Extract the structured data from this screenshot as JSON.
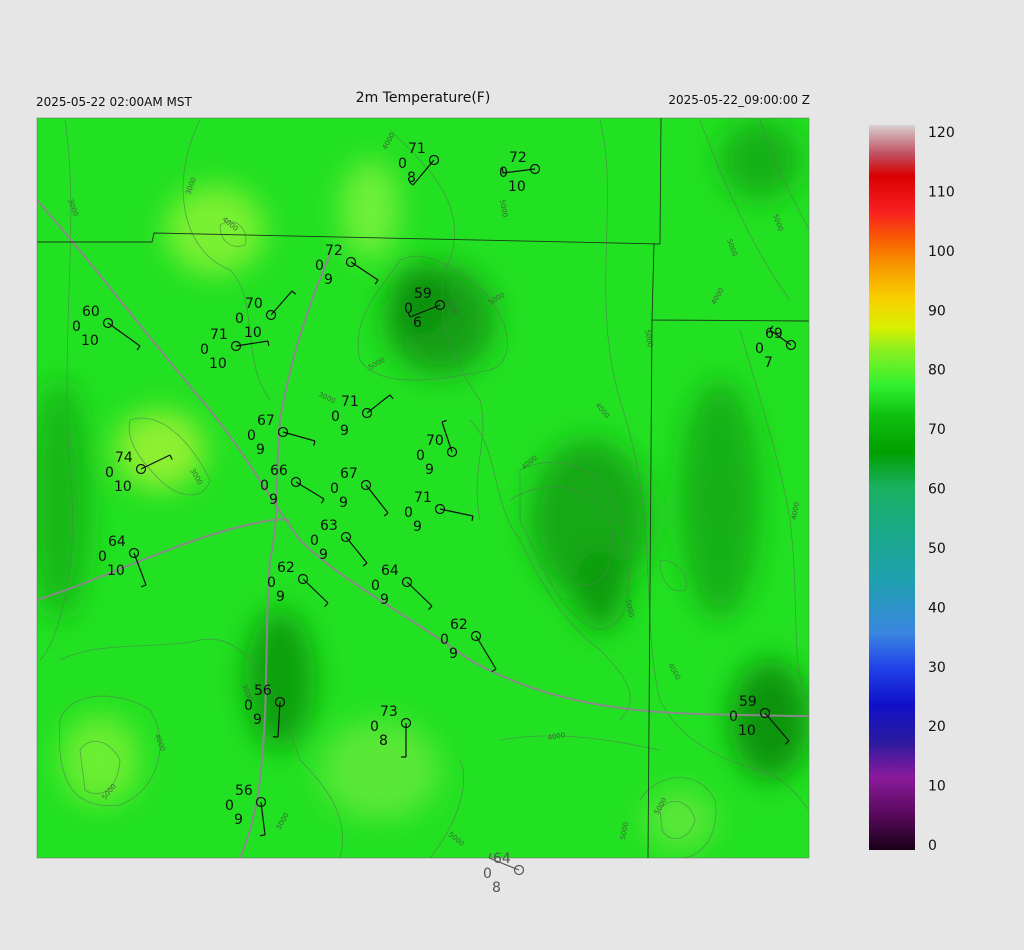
{
  "header": {
    "local_time": "2025-05-22 02:00AM MST",
    "title": "2m Temperature(F)",
    "utc_time": "2025-05-22_09:00:00 Z"
  },
  "colorbar": {
    "min": 0,
    "max": 120,
    "labels": [
      "120",
      "110",
      "100",
      "90",
      "80",
      "70",
      "60",
      "50",
      "40",
      "30",
      "20",
      "10",
      "0"
    ]
  },
  "contour_labels": [
    "3000",
    "4000",
    "5000"
  ],
  "stations": [
    {
      "temp": "71",
      "dew": "0",
      "vis": "8"
    },
    {
      "temp": "72",
      "dew": "0",
      "vis": "10"
    },
    {
      "temp": "72",
      "dew": "0",
      "vis": "9"
    },
    {
      "temp": "59",
      "dew": "0",
      "vis": "6"
    },
    {
      "temp": "70",
      "dew": "0",
      "vis": "10"
    },
    {
      "temp": "60",
      "dew": "0",
      "vis": "10"
    },
    {
      "temp": "71",
      "dew": "0",
      "vis": "10"
    },
    {
      "temp": "69",
      "dew": "0",
      "vis": "7"
    },
    {
      "temp": "71",
      "dew": "0",
      "vis": "9"
    },
    {
      "temp": "67",
      "dew": "0",
      "vis": "9"
    },
    {
      "temp": "70",
      "dew": "0",
      "vis": "9"
    },
    {
      "temp": "74",
      "dew": "0",
      "vis": "10"
    },
    {
      "temp": "66",
      "dew": "0",
      "vis": "9"
    },
    {
      "temp": "67",
      "dew": "0",
      "vis": "9"
    },
    {
      "temp": "71",
      "dew": "0",
      "vis": "9"
    },
    {
      "temp": "63",
      "dew": "0",
      "vis": "9"
    },
    {
      "temp": "64",
      "dew": "0",
      "vis": "10"
    },
    {
      "temp": "62",
      "dew": "0",
      "vis": "9"
    },
    {
      "temp": "64",
      "dew": "0",
      "vis": "9"
    },
    {
      "temp": "62",
      "dew": "0",
      "vis": "9"
    },
    {
      "temp": "56",
      "dew": "0",
      "vis": "9"
    },
    {
      "temp": "73",
      "dew": "0",
      "vis": "8"
    },
    {
      "temp": "59",
      "dew": "0",
      "vis": "10"
    },
    {
      "temp": "56",
      "dew": "0",
      "vis": "9"
    },
    {
      "temp": "64",
      "dew": "0",
      "vis": "8"
    }
  ]
}
